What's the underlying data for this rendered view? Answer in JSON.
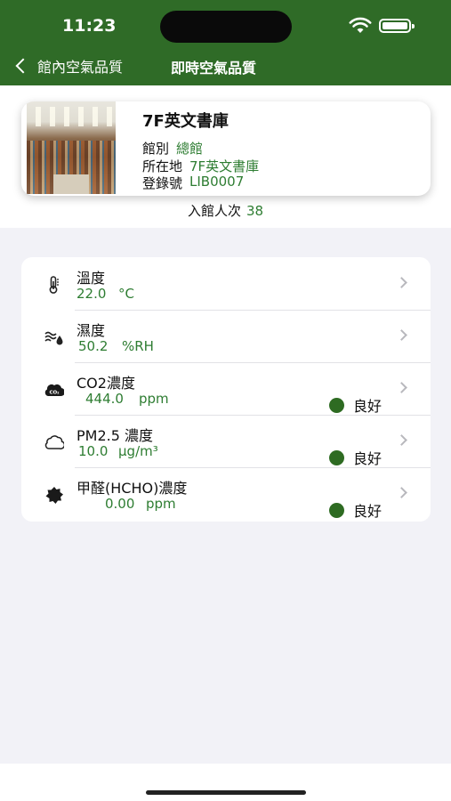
{
  "status_bar": {
    "time": "11:23"
  },
  "nav": {
    "back_label": "館內空氣品質",
    "title": "即時空氣品質"
  },
  "location": {
    "name": "7F英文書庫",
    "fields": [
      {
        "key": "館別",
        "value": "總館"
      },
      {
        "key": "所在地",
        "value": "7F英文書庫"
      },
      {
        "key": "登錄號",
        "value": "LIB0007"
      }
    ],
    "visitors_label": "入館人次",
    "visitors_value": "38"
  },
  "readings": [
    {
      "label": "溫度",
      "value": "22.0",
      "unit": "°C",
      "icon": "thermometer-icon",
      "status": ""
    },
    {
      "label": "濕度",
      "value": "50.2",
      "unit": "%RH",
      "icon": "humidity-icon",
      "status": ""
    },
    {
      "label": "CO2濃度",
      "value": "444.0",
      "unit": "ppm",
      "icon": "co2-cloud-icon",
      "status": "良好"
    },
    {
      "label": "PM2.5 濃度",
      "value": "10.0",
      "unit": "µg/m³",
      "icon": "pm25-cloud-icon",
      "status": "良好"
    },
    {
      "label": "甲醛(HCHO)濃度",
      "value": "0.00",
      "unit": "ppm",
      "icon": "hcho-icon",
      "status": "良好"
    }
  ],
  "colors": {
    "nav_green": "#2f6b27",
    "value_green": "#2e7d32",
    "status_dot": "#2e6b22"
  }
}
